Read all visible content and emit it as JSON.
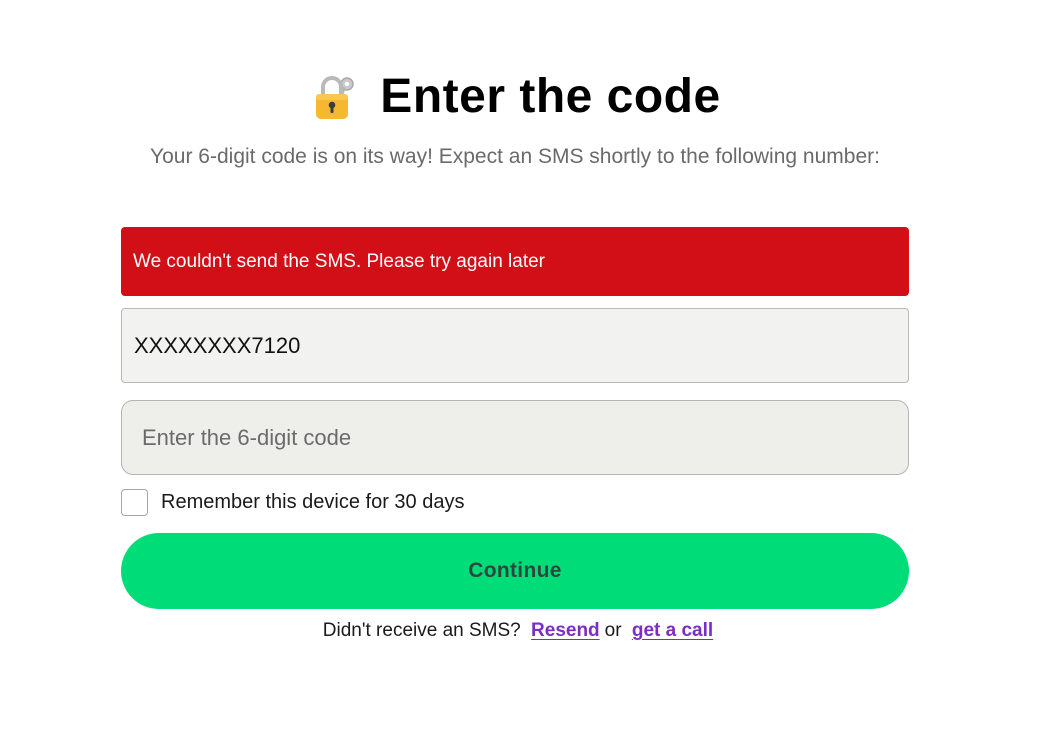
{
  "header": {
    "icon": "lock-with-key-icon",
    "title": "Enter the code",
    "subtitle": "Your 6-digit code is on its way! Expect an SMS shortly to the following number:"
  },
  "error": {
    "message": "We couldn't send the SMS. Please try again later",
    "color": "#d20f16"
  },
  "phone": {
    "value": "XXXXXXXX7120"
  },
  "code_input": {
    "value": "",
    "placeholder": "Enter the 6-digit code"
  },
  "remember": {
    "label": "Remember this device for 30 days",
    "checked": false
  },
  "continue_button": {
    "label": "Continue",
    "color": "#00dc78"
  },
  "footer": {
    "prompt": "Didn't receive an SMS?",
    "resend_label": "Resend",
    "or_text": "or",
    "call_label": "get a call",
    "link_color": "#7a2ec4"
  }
}
